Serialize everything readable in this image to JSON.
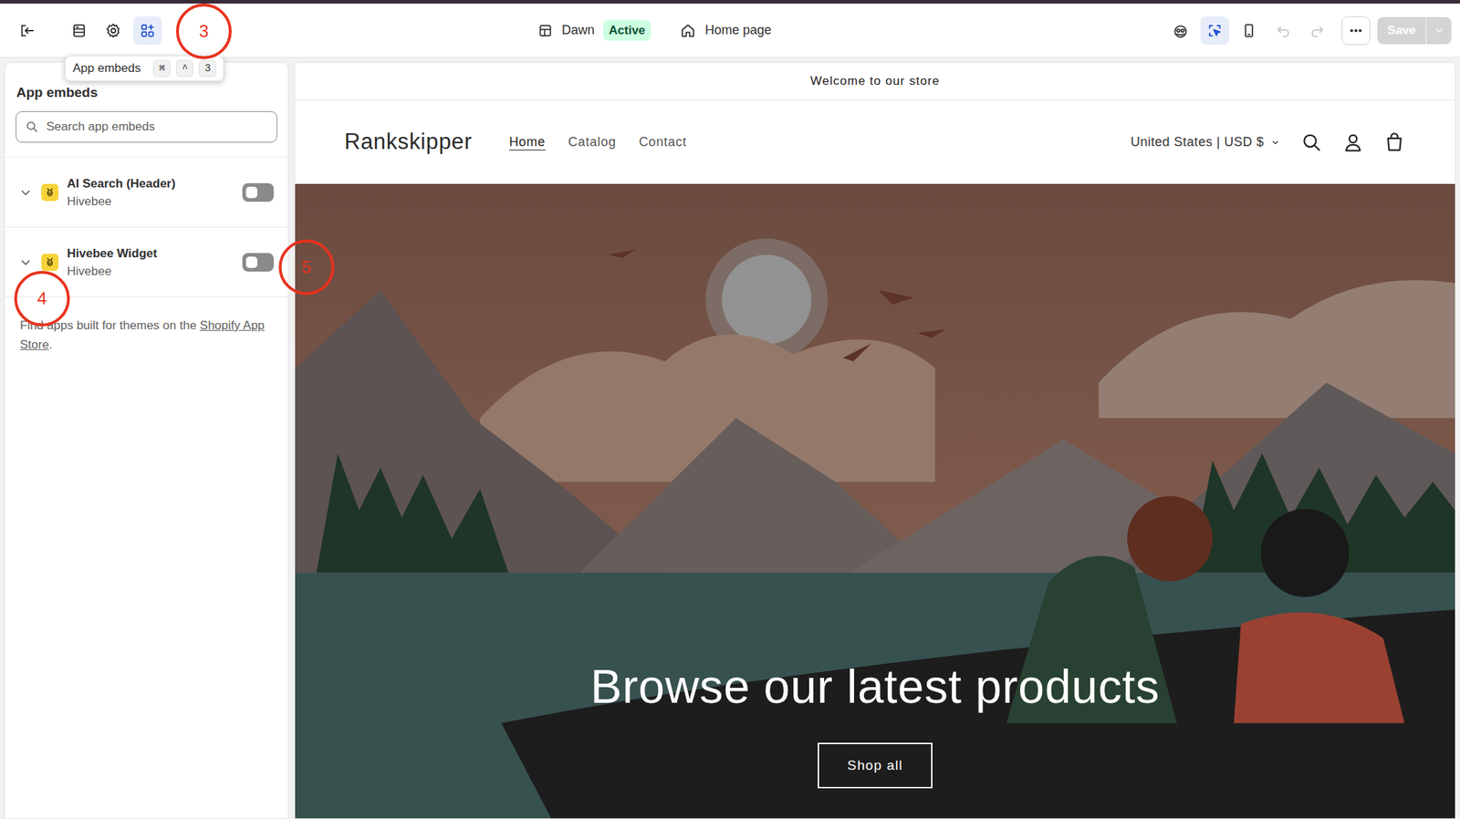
{
  "topbar": {
    "theme_name": "Dawn",
    "theme_status": "Active",
    "page": "Home page"
  },
  "left_tools": [
    {
      "kind": "sections",
      "selected": false
    },
    {
      "kind": "settings",
      "selected": false
    },
    {
      "kind": "app-embeds",
      "selected": true
    }
  ],
  "right_tools": [
    {
      "kind": "preview",
      "selected": false,
      "disabled": false
    },
    {
      "kind": "inspector",
      "selected": true,
      "disabled": false
    },
    {
      "kind": "mobile",
      "selected": false,
      "disabled": false
    },
    {
      "kind": "undo",
      "selected": false,
      "disabled": true
    },
    {
      "kind": "redo",
      "selected": false,
      "disabled": true
    },
    {
      "kind": "more",
      "selected": false,
      "disabled": false
    }
  ],
  "save": {
    "label": "Save",
    "disabled": true
  },
  "tooltip": {
    "label": "App embeds",
    "keys": [
      "⌘",
      "^",
      "3"
    ]
  },
  "panel": {
    "title": "App embeds",
    "search_placeholder": "Search app embeds",
    "embeds": [
      {
        "name": "AI Search (Header)",
        "app": "Hivebee",
        "enabled": false,
        "expanded": false
      },
      {
        "name": "Hivebee Widget",
        "app": "Hivebee",
        "enabled": false,
        "expanded": false
      }
    ],
    "footer_text": "Find apps built for themes on the ",
    "footer_link": "Shopify App Store",
    "footer_end": "."
  },
  "annotations": [
    {
      "label": "3"
    },
    {
      "label": "4"
    },
    {
      "label": "5"
    }
  ],
  "preview": {
    "announcement": "Welcome to our store",
    "brand": "Rankskipper",
    "nav": [
      {
        "label": "Home",
        "selected": true
      },
      {
        "label": "Catalog",
        "selected": false
      },
      {
        "label": "Contact",
        "selected": false
      }
    ],
    "locale": "United States | USD $",
    "hero_heading": "Browse our latest products",
    "hero_button": "Shop all"
  }
}
